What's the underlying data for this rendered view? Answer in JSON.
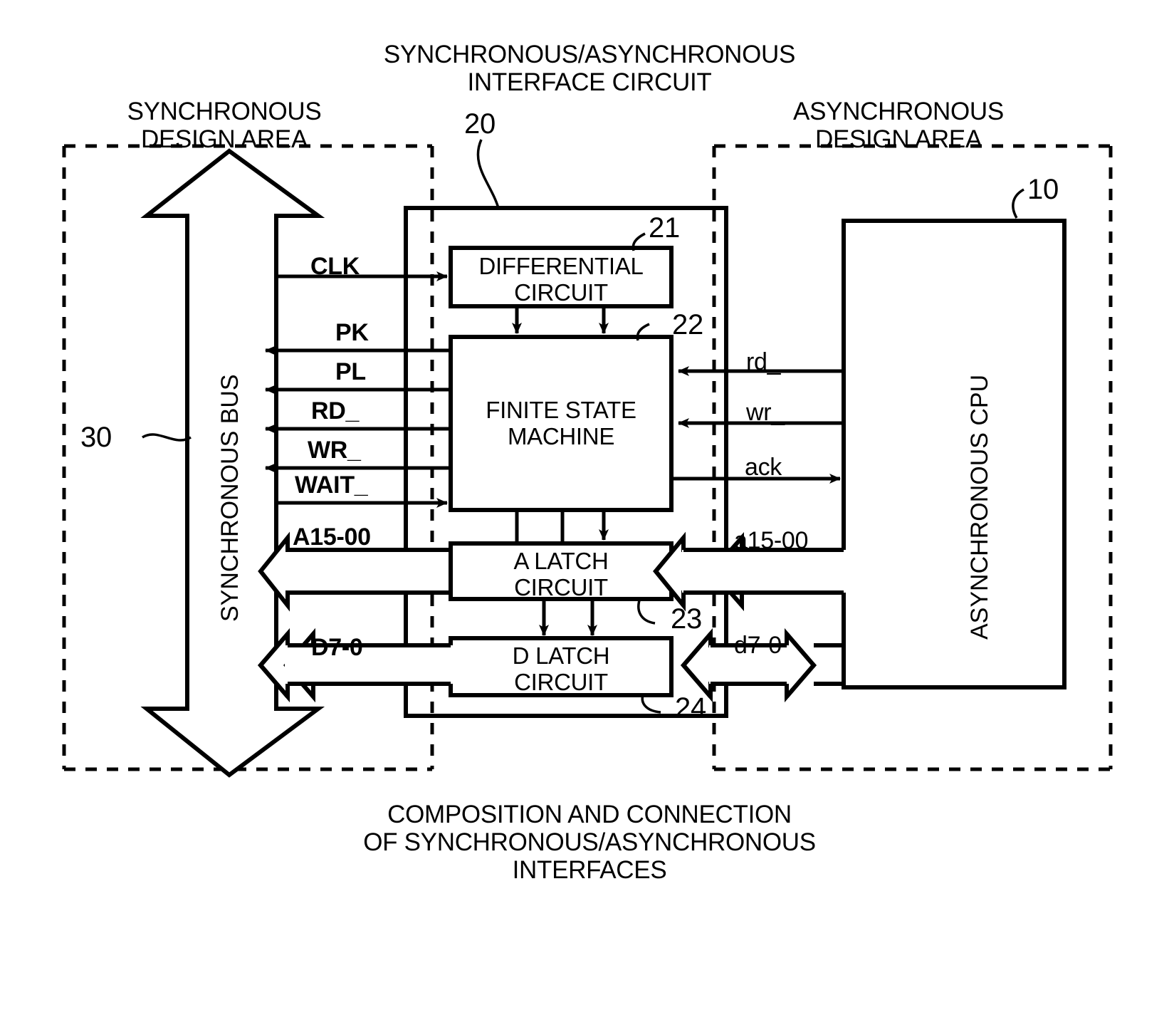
{
  "figure": {
    "top_title": "SYNCHRONOUS/ASYNCHRONOUS\nINTERFACE CIRCUIT",
    "caption": "COMPOSITION AND CONNECTION\nOF SYNCHRONOUS/ASYNCHRONOUS\nINTERFACES",
    "left_area_title": "SYNCHRONOUS\nDESIGN AREA",
    "right_area_title": "ASYNCHRONOUS\nDESIGN AREA"
  },
  "refs": {
    "cpu": "10",
    "interface": "20",
    "differential": "21",
    "fsm": "22",
    "a_latch": "23",
    "d_latch": "24",
    "bus": "30"
  },
  "blocks": {
    "differential": "DIFFERENTIAL\nCIRCUIT",
    "fsm": "FINITE STATE\nMACHINE",
    "a_latch": "A LATCH\nCIRCUIT",
    "d_latch": "D LATCH\nCIRCUIT",
    "cpu": "ASYNCHRONOUS CPU",
    "bus": "SYNCHRONOUS BUS"
  },
  "sync_signals": [
    {
      "name": "CLK",
      "direction": "right"
    },
    {
      "name": "PK",
      "direction": "left"
    },
    {
      "name": "PL",
      "direction": "left"
    },
    {
      "name": "RD_",
      "direction": "left"
    },
    {
      "name": "WR_",
      "direction": "left"
    },
    {
      "name": "WAIT_",
      "direction": "right"
    },
    {
      "name": "A15-00",
      "direction": "left-bus"
    },
    {
      "name": "D7-0",
      "direction": "bidir-bus"
    }
  ],
  "async_signals": [
    {
      "name": "rd_",
      "direction": "left"
    },
    {
      "name": "wr_",
      "direction": "left"
    },
    {
      "name": "ack_",
      "direction": "right"
    },
    {
      "name": "a15-00",
      "direction": "left-bus"
    },
    {
      "name": "d7-0",
      "direction": "bidir-bus"
    }
  ],
  "colors": {
    "stroke": "#000000",
    "background": "#ffffff"
  }
}
